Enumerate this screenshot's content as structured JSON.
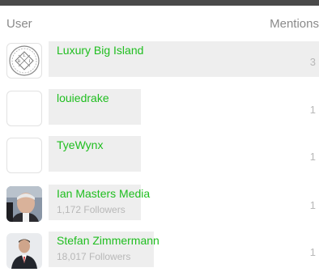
{
  "header": {
    "user_label": "User",
    "mentions_label": "Mentions"
  },
  "rows": [
    {
      "name": "Luxury Big Island",
      "followers": "",
      "count": "3",
      "avatar": "emblem-logo-icon",
      "mention_share": 1.0
    },
    {
      "name": "louiedrake",
      "followers": "",
      "count": "1",
      "avatar": "blank-avatar",
      "mention_share": 0.333
    },
    {
      "name": "TyeWynx",
      "followers": "",
      "count": "1",
      "avatar": "blank-avatar",
      "mention_share": 0.333
    },
    {
      "name": "Ian Masters Media",
      "followers": "1,172 Followers",
      "count": "1",
      "avatar": "man-portrait-avatar",
      "mention_share": 0.333
    },
    {
      "name": "Stefan Zimmermann",
      "followers": "18,017 Followers",
      "count": "1",
      "avatar": "man-suit-avatar",
      "mention_share": 0.333
    }
  ]
}
